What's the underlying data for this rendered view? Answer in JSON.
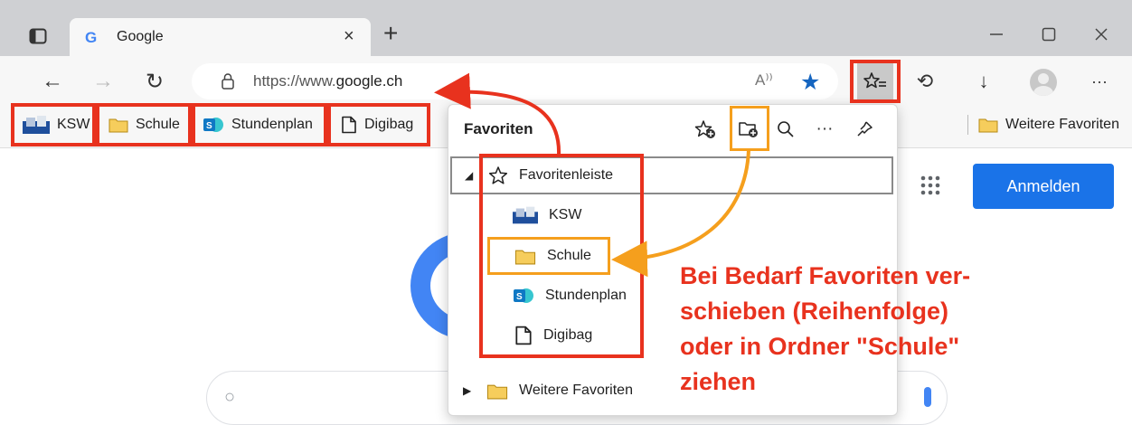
{
  "browser": {
    "tab": {
      "favicon": "G",
      "title": "Google",
      "close": "×"
    },
    "new_tab": "+",
    "window": {
      "minimize": "—",
      "maximize": "☐",
      "close": "✕"
    }
  },
  "toolbar": {
    "back": "←",
    "forward": "→",
    "refresh": "↻",
    "url_prefix": "https://www.",
    "url_domain": "google.ch",
    "read_aloud": "A⁾⁾",
    "history": "⟲",
    "downloads": "↓",
    "more": "···"
  },
  "favorites_bar": {
    "items": [
      {
        "label": "KSW",
        "icon": "ksw-image-icon"
      },
      {
        "label": "Schule",
        "icon": "folder-icon"
      },
      {
        "label": "Stundenplan",
        "icon": "sharepoint-icon"
      },
      {
        "label": "Digibag",
        "icon": "page-icon"
      }
    ],
    "more_label": "Weitere Favoriten"
  },
  "flyout": {
    "title": "Favoriten",
    "tree": [
      {
        "label": "Favoritenleiste",
        "icon": "star-outline-icon",
        "expanded": true
      },
      {
        "label": "KSW",
        "icon": "ksw-image-icon"
      },
      {
        "label": "Schule",
        "icon": "folder-icon"
      },
      {
        "label": "Stundenplan",
        "icon": "sharepoint-icon"
      },
      {
        "label": "Digibag",
        "icon": "page-icon"
      },
      {
        "label": "Weitere Favoriten",
        "icon": "folder-icon",
        "expanded": false
      }
    ]
  },
  "google": {
    "signin_label": "Anmelden"
  },
  "annotation": {
    "lines": [
      "Bei Bedarf Favoriten ver-",
      "schieben (Reihenfolge)",
      "oder in Ordner \"Schule\"",
      "ziehen"
    ]
  },
  "colors": {
    "annotation_red": "#e8321e",
    "annotation_orange": "#f59f1d",
    "accent_blue": "#1a73e8",
    "folder_yellow": "#f6cd5c",
    "sharepoint_teal": "#0f78c4"
  }
}
